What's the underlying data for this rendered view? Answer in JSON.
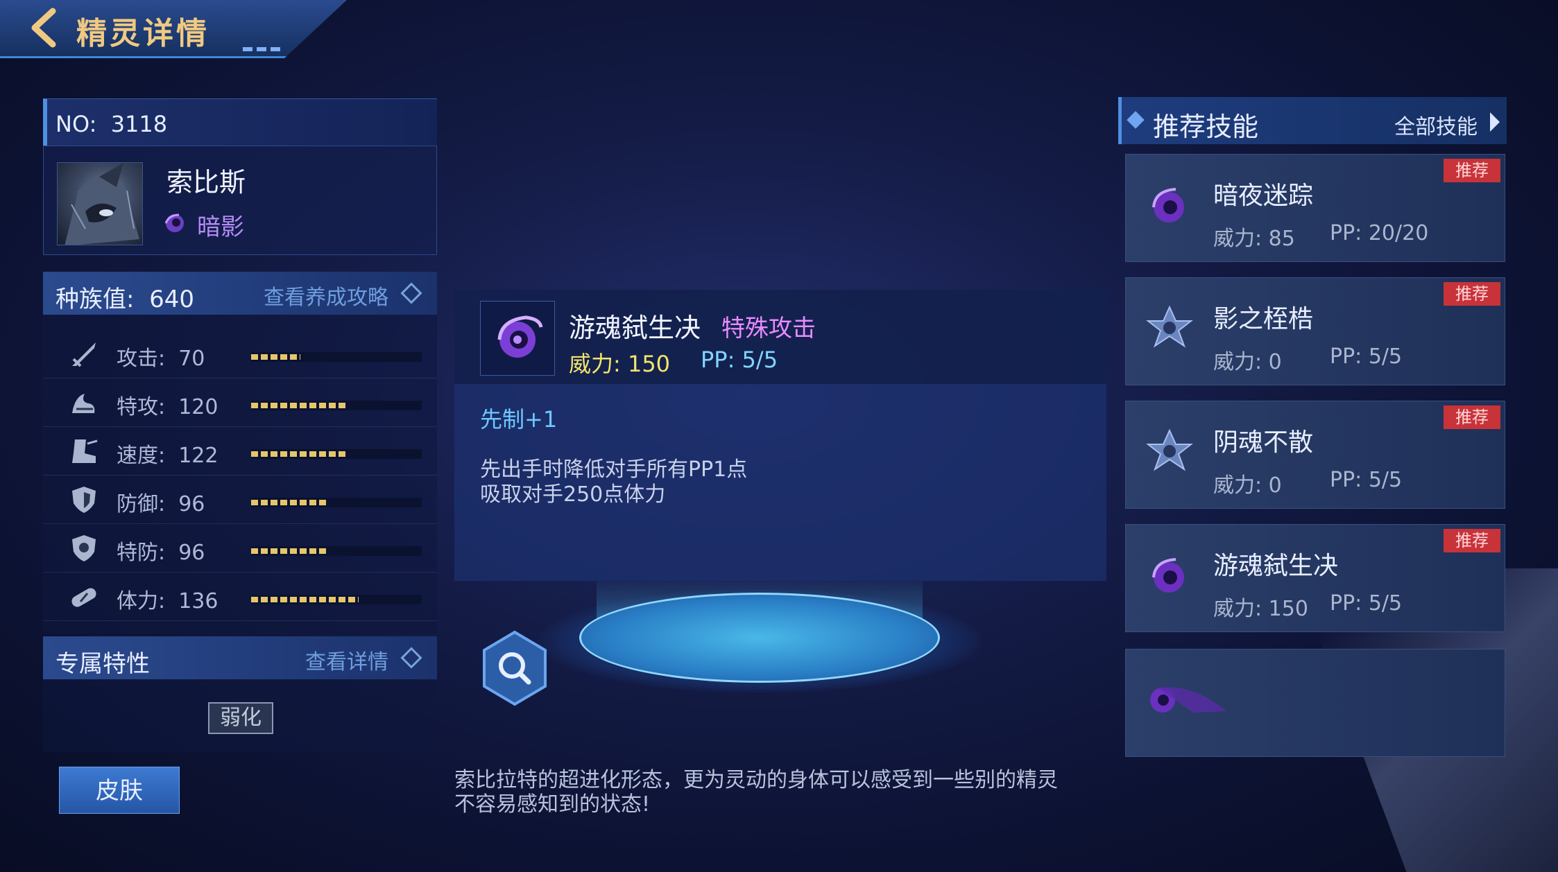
{
  "header": {
    "title": "精灵详情"
  },
  "creature": {
    "no_label": "NO:",
    "no_value": "3118",
    "name": "索比斯",
    "attribute": "暗影",
    "race_label": "种族值:",
    "race_value": "640",
    "race_link": "查看养成攻略",
    "stats": [
      {
        "label": "攻击:",
        "value": "70",
        "icon": "sword-icon",
        "level": 0.29
      },
      {
        "label": "特攻:",
        "value": "120",
        "icon": "special-attack-icon",
        "level": 0.56
      },
      {
        "label": "速度:",
        "value": "122",
        "icon": "boot-icon",
        "level": 0.57
      },
      {
        "label": "防御:",
        "value": "96",
        "icon": "shield-icon",
        "level": 0.45
      },
      {
        "label": "特防:",
        "value": "96",
        "icon": "special-defense-icon",
        "level": 0.45
      },
      {
        "label": "体力:",
        "value": "136",
        "icon": "health-icon",
        "level": 0.63
      }
    ],
    "trait_label": "专属特性",
    "trait_link": "查看详情",
    "trait_badge": "弱化",
    "skin_button": "皮肤",
    "bio_line1": "索比拉特的超进化形态，更为灵动的身体可以感受到一些别的精灵",
    "bio_line2": "不容易感知到的状态!"
  },
  "skill_detail": {
    "name": "游魂弑生决",
    "type": "特殊攻击",
    "power_text": "威力:  150",
    "pp_text": "PP:  5/5",
    "priority": "先制+1",
    "desc_line1": "先出手时降低对手所有PP1点",
    "desc_line2": "吸取对手250点体力"
  },
  "recommend": {
    "title": "推荐技能",
    "all_link": "全部技能",
    "tag": "推荐",
    "skills": [
      {
        "name": "暗夜迷踪",
        "power": "威力:  85",
        "pp": "PP:  20/20",
        "icon": "shadow-swirl-icon"
      },
      {
        "name": "影之桎梏",
        "power": "威力:  0",
        "pp": "PP:  5/5",
        "icon": "star-emblem-icon"
      },
      {
        "name": "阴魂不散",
        "power": "威力:  0",
        "pp": "PP:  5/5",
        "icon": "star-emblem-icon"
      },
      {
        "name": "游魂弑生决",
        "power": "威力:  150",
        "pp": "PP:  5/5",
        "icon": "shadow-swirl-icon"
      }
    ]
  },
  "colors": {
    "accent": "#4f8fe0",
    "shadow_attr": "#b58cf5",
    "tag_red": "#c8333a",
    "power_yellow": "#f3e46a",
    "pp_cyan": "#82d6ff"
  }
}
